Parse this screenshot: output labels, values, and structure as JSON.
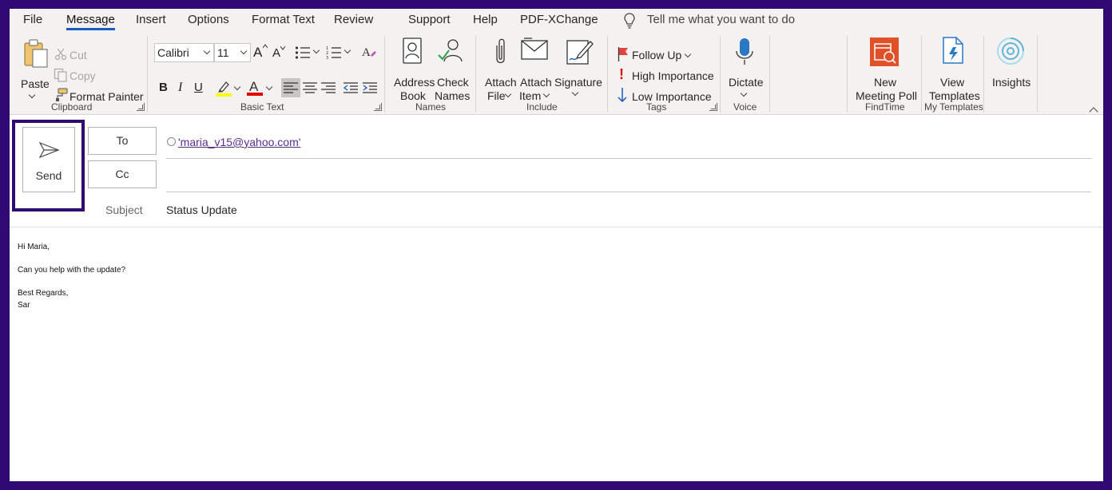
{
  "menu": {
    "tabs": [
      {
        "label": "File"
      },
      {
        "label": "Message"
      },
      {
        "label": "Insert"
      },
      {
        "label": "Options"
      },
      {
        "label": "Format Text"
      },
      {
        "label": "Review"
      },
      {
        "label": "Support"
      },
      {
        "label": "Help"
      },
      {
        "label": "PDF-XChange"
      }
    ],
    "active_tab": "Message",
    "tell_me": "Tell me what you want to do"
  },
  "ribbon": {
    "clipboard": {
      "paste": "Paste",
      "cut": "Cut",
      "copy": "Copy",
      "format_painter": "Format Painter",
      "label": "Clipboard"
    },
    "basic_text": {
      "font": "Calibri",
      "size": "11",
      "bold": "B",
      "italic": "I",
      "underline": "U",
      "font_color_letter": "A",
      "grow_font": "A",
      "shrink_font": "A",
      "label": "Basic Text"
    },
    "names": {
      "address_book_1": "Address",
      "address_book_2": "Book",
      "check_names_1": "Check",
      "check_names_2": "Names",
      "label": "Names"
    },
    "include": {
      "attach_file_1": "Attach",
      "attach_file_2": "File",
      "attach_item_1": "Attach",
      "attach_item_2": "Item",
      "signature": "Signature",
      "label": "Include"
    },
    "tags": {
      "follow_up": "Follow Up",
      "high_importance": "High Importance",
      "low_importance": "Low Importance",
      "label": "Tags"
    },
    "voice": {
      "dictate": "Dictate",
      "label": "Voice"
    },
    "findtime": {
      "new_1": "New",
      "new_2": "Meeting Poll",
      "label": "FindTime"
    },
    "my_templates": {
      "view_1": "View",
      "view_2": "Templates",
      "label": "My Templates"
    },
    "insights": {
      "label": "Insights"
    }
  },
  "compose": {
    "send": "Send",
    "to_button": "To",
    "cc_button": "Cc",
    "to_value": "'maria_v15@yahoo.com'",
    "cc_value": "",
    "subject_label": "Subject",
    "subject_value": "Status Update"
  },
  "body": {
    "lines": [
      "Hi Maria,",
      "Can you help with the update?",
      "Best Regards,",
      "Sar"
    ]
  },
  "colors": {
    "frame": "#2e0a72",
    "accent": "#185abd",
    "findtime_orange": "#e0512a",
    "templates_blue": "#2b78c5",
    "insights_teal": "#5fb4d8",
    "highlight_yellow": "#ffff00",
    "font_red": "#e00000"
  }
}
